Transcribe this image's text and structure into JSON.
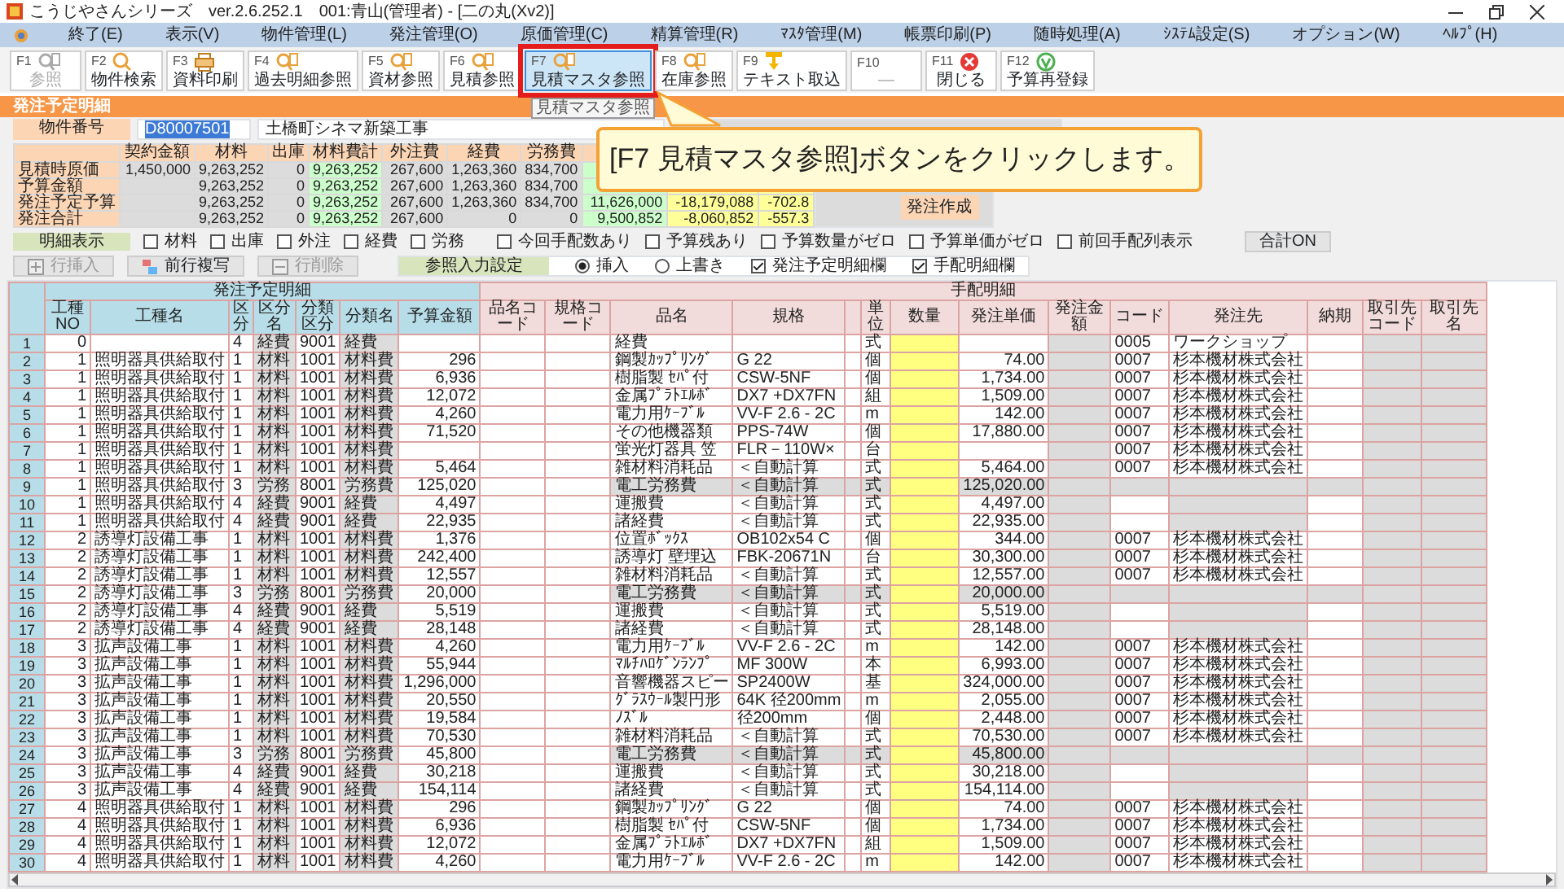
{
  "window": {
    "title": "こうじやさんシリーズ　ver.2.6.252.1　001:青山(管理者) - [二の丸(Xv2)]"
  },
  "menu": [
    "終了(E)",
    "表示(V)",
    "物件管理(L)",
    "発注管理(O)",
    "原価管理(C)",
    "精算管理(R)",
    "ﾏｽﾀ管理(M)",
    "帳票印刷(P)",
    "随時処理(A)",
    "ｼｽﾃﾑ設定(S)",
    "オプション(W)",
    "ﾍﾙﾌﾟ(H)"
  ],
  "toolbar": [
    {
      "key": "F1",
      "label": "参照",
      "disabled": true,
      "selected": false
    },
    {
      "key": "F2",
      "label": "物件検索",
      "disabled": false,
      "selected": false
    },
    {
      "key": "F3",
      "label": "資料印刷",
      "disabled": false,
      "selected": false
    },
    {
      "key": "F4",
      "label": "過去明細参照",
      "disabled": false,
      "selected": false
    },
    {
      "key": "F5",
      "label": "資材参照",
      "disabled": false,
      "selected": false
    },
    {
      "key": "F6",
      "label": "見積参照",
      "disabled": false,
      "selected": false
    },
    {
      "key": "F7",
      "label": "見積マスタ参照",
      "disabled": false,
      "selected": true
    },
    {
      "key": "F8",
      "label": "在庫参照",
      "disabled": false,
      "selected": false
    },
    {
      "key": "F9",
      "label": "テキスト取込",
      "disabled": false,
      "selected": false
    },
    {
      "key": "F10",
      "label": "—",
      "disabled": true,
      "selected": false
    },
    {
      "key": "F11",
      "label": "閉じる",
      "disabled": false,
      "selected": false
    },
    {
      "key": "F12",
      "label": "予算再登録",
      "disabled": false,
      "selected": false
    }
  ],
  "tooltip": "見積マスタ参照",
  "section_title": "発注予定明細",
  "property": {
    "label": "物件番号",
    "number": "D80007501",
    "name": "土橋町シネマ新築工事"
  },
  "summary": {
    "columns": [
      "契約金額",
      "材料",
      "出庫",
      "材料費計",
      "外注費",
      "経費",
      "労務費"
    ],
    "rows": [
      {
        "label": "見積時原価",
        "contract": "1,450,000",
        "material": "9,263,252",
        "issue": "0",
        "material_total": "9,263,252",
        "outsourcing": "267,600",
        "expense": "1,263,360",
        "labor": "834,700"
      },
      {
        "label": "予算金額",
        "material": "9,263,252",
        "issue": "0",
        "material_total": "9,263,252",
        "outsourcing": "267,600",
        "expense": "1,263,360",
        "labor": "834,700"
      },
      {
        "label": "発注予定予算",
        "material": "9,263,252",
        "issue": "0",
        "material_total": "9,263,252",
        "outsourcing": "267,600",
        "expense": "1,263,360",
        "labor": "834,700",
        "column_8": "11,626,000",
        "column_9": "-18,179,088",
        "column_10": "-702.8"
      },
      {
        "label": "発注合計",
        "material": "9,263,252",
        "issue": "0",
        "material_total": "9,263,252",
        "outsourcing": "267,600",
        "expense": "0",
        "labor": "0",
        "column_8": "9,500,852",
        "column_9": "-8,060,852",
        "column_10": "-557.3"
      }
    ],
    "action_button": "発注作成"
  },
  "callout": "[F7 見積マスタ参照]ボタンをクリックします。",
  "filters": {
    "label": "明細表示",
    "items": [
      {
        "label": "材料",
        "checked": false
      },
      {
        "label": "出庫",
        "checked": false
      },
      {
        "label": "外注",
        "checked": false
      },
      {
        "label": "経費",
        "checked": false
      },
      {
        "label": "労務",
        "checked": false
      },
      {
        "label": "今回手配数あり",
        "checked": false
      },
      {
        "label": "予算残あり",
        "checked": false
      },
      {
        "label": "予算数量がゼロ",
        "checked": false
      },
      {
        "label": "予算単価がゼロ",
        "checked": false
      },
      {
        "label": "前回手配列表示",
        "checked": false
      }
    ],
    "total_button": "合計ON"
  },
  "row_buttons": [
    {
      "label": "行挿入",
      "disabled": true
    },
    {
      "label": "前行複写",
      "disabled": false
    },
    {
      "label": "行削除",
      "disabled": true
    }
  ],
  "ref_setting": {
    "label": "参照入力設定",
    "modes": [
      {
        "label": "挿入",
        "selected": true
      },
      {
        "label": "上書き",
        "selected": false
      }
    ],
    "columns": [
      {
        "label": "発注予定明細欄",
        "checked": true
      },
      {
        "label": "手配明細欄",
        "checked": true
      }
    ]
  },
  "grid": {
    "groups": [
      {
        "label": "発注予定明細",
        "columns": [
          "工種NO",
          "工種名",
          "区分",
          "区分名",
          "分類区分",
          "分類名",
          "予算金額"
        ]
      },
      {
        "label": "手配明細",
        "columns": [
          "品名コード",
          "規格コード",
          "品名",
          "規格",
          "単位",
          "数量",
          "発注単価",
          "発注金額",
          "コード",
          "発注先",
          "納期",
          "取引先コード",
          "取引先名"
        ]
      }
    ],
    "rows": [
      {
        "no": "1",
        "kind": "expense",
        "cells": [
          "0",
          null,
          "4",
          "経費",
          "9001",
          "経費",
          null,
          null,
          null,
          "経費",
          null,
          "式",
          null,
          null,
          null,
          "0005",
          "ワークショップ",
          null,
          null,
          null
        ]
      },
      {
        "no": "2",
        "kind": "material",
        "cells": [
          "1",
          "照明器具供給取付",
          "1",
          "材料",
          "1001",
          "材料費",
          "296",
          null,
          null,
          "鋼製ｶｯﾌﾟﾘﾝｸﾞ",
          "G 22",
          "個",
          null,
          "74.00",
          null,
          "0007",
          "杉本機材株式会社",
          null,
          null,
          null
        ]
      },
      {
        "no": "3",
        "kind": "material",
        "cells": [
          "1",
          "照明器具供給取付",
          "1",
          "材料",
          "1001",
          "材料費",
          "6,936",
          null,
          null,
          "樹脂製 ｾﾊﾟ付",
          "CSW-5NF",
          "個",
          null,
          "1,734.00",
          null,
          "0007",
          "杉本機材株式会社",
          null,
          null,
          null
        ]
      },
      {
        "no": "4",
        "kind": "material",
        "cells": [
          "1",
          "照明器具供給取付",
          "1",
          "材料",
          "1001",
          "材料費",
          "12,072",
          null,
          null,
          "金属ﾌﾟﾗﾄｴﾙﾎﾞ",
          "DX7 +DX7FN",
          "組",
          null,
          "1,509.00",
          null,
          "0007",
          "杉本機材株式会社",
          null,
          null,
          null
        ]
      },
      {
        "no": "5",
        "kind": "material",
        "cells": [
          "1",
          "照明器具供給取付",
          "1",
          "材料",
          "1001",
          "材料費",
          "4,260",
          null,
          null,
          "電力用ｹｰﾌﾞﾙ",
          "VV-F 2.6 - 2C",
          "m",
          null,
          "142.00",
          null,
          "0007",
          "杉本機材株式会社",
          null,
          null,
          null
        ]
      },
      {
        "no": "6",
        "kind": "material",
        "cells": [
          "1",
          "照明器具供給取付",
          "1",
          "材料",
          "1001",
          "材料費",
          "71,520",
          null,
          null,
          "その他機器類",
          "PPS-74W",
          "個",
          null,
          "17,880.00",
          null,
          "0007",
          "杉本機材株式会社",
          null,
          null,
          null
        ]
      },
      {
        "no": "7",
        "kind": "material",
        "cells": [
          "1",
          "照明器具供給取付",
          "1",
          "材料",
          "1001",
          "材料費",
          null,
          null,
          null,
          "蛍光灯器具 笠",
          "FLR－110W×",
          "台",
          null,
          null,
          null,
          "0007",
          "杉本機材株式会社",
          null,
          null,
          null
        ]
      },
      {
        "no": "8",
        "kind": "material",
        "cells": [
          "1",
          "照明器具供給取付",
          "1",
          "材料",
          "1001",
          "材料費",
          "5,464",
          null,
          null,
          "雑材料消耗品",
          "＜自動計算",
          "式",
          null,
          "5,464.00",
          null,
          "0007",
          "杉本機材株式会社",
          null,
          null,
          null
        ]
      },
      {
        "no": "9",
        "kind": "labor",
        "cells": [
          "1",
          "照明器具供給取付",
          "3",
          "労務",
          "8001",
          "労務費",
          "125,020",
          null,
          null,
          "電工労務費",
          "＜自動計算",
          "式",
          null,
          "125,020.00",
          null,
          null,
          null,
          null,
          null,
          null
        ]
      },
      {
        "no": "10",
        "kind": "expense",
        "cells": [
          "1",
          "照明器具供給取付",
          "4",
          "経費",
          "9001",
          "経費",
          "4,497",
          null,
          null,
          "運搬費",
          "＜自動計算",
          "式",
          null,
          "4,497.00",
          null,
          null,
          null,
          null,
          null,
          null
        ]
      },
      {
        "no": "11",
        "kind": "expense",
        "cells": [
          "1",
          "照明器具供給取付",
          "4",
          "経費",
          "9001",
          "経費",
          "22,935",
          null,
          null,
          "諸経費",
          "＜自動計算",
          "式",
          null,
          "22,935.00",
          null,
          null,
          null,
          null,
          null,
          null
        ]
      },
      {
        "no": "12",
        "kind": "material",
        "cells": [
          "2",
          "誘導灯設備工事",
          "1",
          "材料",
          "1001",
          "材料費",
          "1,376",
          null,
          null,
          "位置ﾎﾞｯｸｽ",
          "OB102x54 C",
          "個",
          null,
          "344.00",
          null,
          "0007",
          "杉本機材株式会社",
          null,
          null,
          null
        ]
      },
      {
        "no": "13",
        "kind": "material",
        "cells": [
          "2",
          "誘導灯設備工事",
          "1",
          "材料",
          "1001",
          "材料費",
          "242,400",
          null,
          null,
          "誘導灯 壁埋込",
          "FBK-20671N",
          "台",
          null,
          "30,300.00",
          null,
          "0007",
          "杉本機材株式会社",
          null,
          null,
          null
        ]
      },
      {
        "no": "14",
        "kind": "material",
        "cells": [
          "2",
          "誘導灯設備工事",
          "1",
          "材料",
          "1001",
          "材料費",
          "12,557",
          null,
          null,
          "雑材料消耗品",
          "＜自動計算",
          "式",
          null,
          "12,557.00",
          null,
          "0007",
          "杉本機材株式会社",
          null,
          null,
          null
        ]
      },
      {
        "no": "15",
        "kind": "labor",
        "cells": [
          "2",
          "誘導灯設備工事",
          "3",
          "労務",
          "8001",
          "労務費",
          "20,000",
          null,
          null,
          "電工労務費",
          "＜自動計算",
          "式",
          null,
          "20,000.00",
          null,
          null,
          null,
          null,
          null,
          null
        ]
      },
      {
        "no": "16",
        "kind": "expense",
        "cells": [
          "2",
          "誘導灯設備工事",
          "4",
          "経費",
          "9001",
          "経費",
          "5,519",
          null,
          null,
          "運搬費",
          "＜自動計算",
          "式",
          null,
          "5,519.00",
          null,
          null,
          null,
          null,
          null,
          null
        ]
      },
      {
        "no": "17",
        "kind": "expense",
        "cells": [
          "2",
          "誘導灯設備工事",
          "4",
          "経費",
          "9001",
          "経費",
          "28,148",
          null,
          null,
          "諸経費",
          "＜自動計算",
          "式",
          null,
          "28,148.00",
          null,
          null,
          null,
          null,
          null,
          null
        ]
      },
      {
        "no": "18",
        "kind": "material",
        "cells": [
          "3",
          "拡声設備工事",
          "1",
          "材料",
          "1001",
          "材料費",
          "4,260",
          null,
          null,
          "電力用ｹｰﾌﾞﾙ",
          "VV-F 2.6 - 2C",
          "m",
          null,
          "142.00",
          null,
          "0007",
          "杉本機材株式会社",
          null,
          null,
          null
        ]
      },
      {
        "no": "19",
        "kind": "material",
        "cells": [
          "3",
          "拡声設備工事",
          "1",
          "材料",
          "1001",
          "材料費",
          "55,944",
          null,
          null,
          "ﾏﾙﾁﾊﾛｹﾞﾝﾗﾝﾌﾟ",
          "MF 300W",
          "本",
          null,
          "6,993.00",
          null,
          "0007",
          "杉本機材株式会社",
          null,
          null,
          null
        ]
      },
      {
        "no": "20",
        "kind": "material",
        "cells": [
          "3",
          "拡声設備工事",
          "1",
          "材料",
          "1001",
          "材料費",
          "1,296,000",
          null,
          null,
          "音響機器スピー",
          "SP2400W",
          "基",
          null,
          "324,000.00",
          null,
          "0007",
          "杉本機材株式会社",
          null,
          null,
          null
        ]
      },
      {
        "no": "21",
        "kind": "material",
        "cells": [
          "3",
          "拡声設備工事",
          "1",
          "材料",
          "1001",
          "材料費",
          "20,550",
          null,
          null,
          "ｸﾞﾗｽｳｰﾙ製円形",
          "64K 径200mm",
          "m",
          null,
          "2,055.00",
          null,
          "0007",
          "杉本機材株式会社",
          null,
          null,
          null
        ]
      },
      {
        "no": "22",
        "kind": "material",
        "cells": [
          "3",
          "拡声設備工事",
          "1",
          "材料",
          "1001",
          "材料費",
          "19,584",
          null,
          null,
          "ﾉｽﾞﾙ",
          "径200mm",
          "個",
          null,
          "2,448.00",
          null,
          "0007",
          "杉本機材株式会社",
          null,
          null,
          null
        ]
      },
      {
        "no": "23",
        "kind": "material",
        "cells": [
          "3",
          "拡声設備工事",
          "1",
          "材料",
          "1001",
          "材料費",
          "70,530",
          null,
          null,
          "雑材料消耗品",
          "＜自動計算",
          "式",
          null,
          "70,530.00",
          null,
          "0007",
          "杉本機材株式会社",
          null,
          null,
          null
        ]
      },
      {
        "no": "24",
        "kind": "labor",
        "cells": [
          "3",
          "拡声設備工事",
          "3",
          "労務",
          "8001",
          "労務費",
          "45,800",
          null,
          null,
          "電工労務費",
          "＜自動計算",
          "式",
          null,
          "45,800.00",
          null,
          null,
          null,
          null,
          null,
          null
        ]
      },
      {
        "no": "25",
        "kind": "expense",
        "cells": [
          "3",
          "拡声設備工事",
          "4",
          "経費",
          "9001",
          "経費",
          "30,218",
          null,
          null,
          "運搬費",
          "＜自動計算",
          "式",
          null,
          "30,218.00",
          null,
          null,
          null,
          null,
          null,
          null
        ]
      },
      {
        "no": "26",
        "kind": "expense",
        "cells": [
          "3",
          "拡声設備工事",
          "4",
          "経費",
          "9001",
          "経費",
          "154,114",
          null,
          null,
          "諸経費",
          "＜自動計算",
          "式",
          null,
          "154,114.00",
          null,
          null,
          null,
          null,
          null,
          null
        ]
      },
      {
        "no": "27",
        "kind": "material",
        "cells": [
          "4",
          "照明器具供給取付",
          "1",
          "材料",
          "1001",
          "材料費",
          "296",
          null,
          null,
          "鋼製ｶｯﾌﾟﾘﾝｸﾞ",
          "G 22",
          "個",
          null,
          "74.00",
          null,
          "0007",
          "杉本機材株式会社",
          null,
          null,
          null
        ]
      },
      {
        "no": "28",
        "kind": "material",
        "cells": [
          "4",
          "照明器具供給取付",
          "1",
          "材料",
          "1001",
          "材料費",
          "6,936",
          null,
          null,
          "樹脂製 ｾﾊﾟ付",
          "CSW-5NF",
          "個",
          null,
          "1,734.00",
          null,
          "0007",
          "杉本機材株式会社",
          null,
          null,
          null
        ]
      },
      {
        "no": "29",
        "kind": "material",
        "cells": [
          "4",
          "照明器具供給取付",
          "1",
          "材料",
          "1001",
          "材料費",
          "12,072",
          null,
          null,
          "金属ﾌﾟﾗﾄｴﾙﾎﾞ",
          "DX7 +DX7FN",
          "組",
          null,
          "1,509.00",
          null,
          "0007",
          "杉本機材株式会社",
          null,
          null,
          null
        ]
      },
      {
        "no": "30",
        "kind": "material",
        "cells": [
          "4",
          "照明器具供給取付",
          "1",
          "材料",
          "1001",
          "材料費",
          "4,260",
          null,
          null,
          "電力用ｹｰﾌﾞﾙ",
          "VV-F 2.6 - 2C",
          "m",
          null,
          "142.00",
          null,
          "0007",
          "杉本機材株式会社",
          null,
          null,
          null
        ]
      }
    ]
  }
}
